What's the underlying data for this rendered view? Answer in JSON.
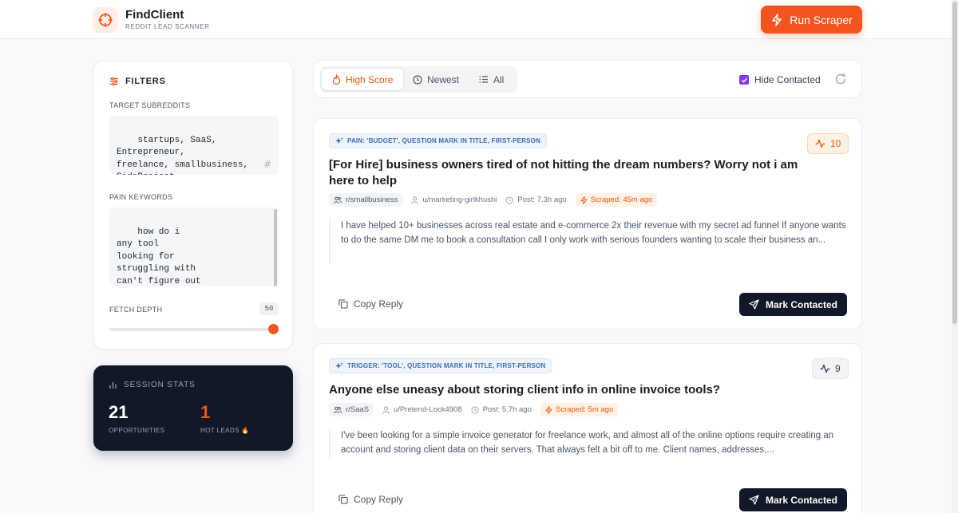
{
  "header": {
    "app_name": "FindClient",
    "app_subtitle": "REDDIT LEAD SCANNER",
    "run_button_label": "Run Scraper",
    "logo_icon": "crosshair-icon",
    "brand_color": "#f4541f"
  },
  "filters": {
    "heading": "FILTERS",
    "subreddits_label": "TARGET SUBREDDITS",
    "subreddits_value": "startups, SaaS, Entrepreneur,\nfreelance, smallbusiness,\nSideProject",
    "keywords_label": "PAIN KEYWORDS",
    "keywords_value": "how do i\nany tool\nlooking for\nstruggling with\ncan't figure out\nis there a way",
    "fetch_depth_label": "FETCH DEPTH",
    "fetch_depth_value": "50",
    "fetch_depth_fraction": 1.0
  },
  "stats": {
    "heading": "SESSION STATS",
    "opportunities_value": "21",
    "opportunities_label": "OPPORTUNITIES",
    "hot_leads_value": "1",
    "hot_leads_label": "HOT LEADS 🔥"
  },
  "toolbar": {
    "tabs": [
      {
        "label": "High Score",
        "icon": "flame-icon",
        "active": true
      },
      {
        "label": "Newest",
        "icon": "clock-icon",
        "active": false
      },
      {
        "label": "All",
        "icon": "list-icon",
        "active": false
      }
    ],
    "hide_contacted_label": "Hide Contacted",
    "hide_contacted_checked": true
  },
  "posts": [
    {
      "tag": "PAIN: 'BUDGET', QUESTION MARK IN TITLE, FIRST-PERSON",
      "score": "10",
      "title": "[For Hire] business owners tired of not hitting the dream numbers? Worry not i am here to help",
      "subreddit": "r/smallbusiness",
      "author": "u/marketing-girlkhushi",
      "posted": "Post: 7.3h ago",
      "scraped": "Scraped: 45m ago",
      "body": "I have helped 10+ businesses across real estate and e-commerce 2x their revenue with my secret ad funnel If anyone wants to do the same DM me to book a consultation call I only work with serious founders wanting to scale their business an...",
      "copy_label": "Copy Reply",
      "mark_label": "Mark Contacted"
    },
    {
      "tag": "TRIGGER: 'TOOL', QUESTION MARK IN TITLE, FIRST-PERSON",
      "score": "9",
      "title": "Anyone else uneasy about storing client info in online invoice tools?",
      "subreddit": "r/SaaS",
      "author": "u/Pretend-Lock4908",
      "posted": "Post: 5.7h ago",
      "scraped": "Scraped: 5m ago",
      "body": "I've been looking for a simple invoice generator for freelance work,  and almost all of the online options require creating an account and storing client data on their servers. That always felt a bit off to me. Client names, addresses,...",
      "copy_label": "Copy Reply",
      "mark_label": "Mark Contacted"
    }
  ]
}
